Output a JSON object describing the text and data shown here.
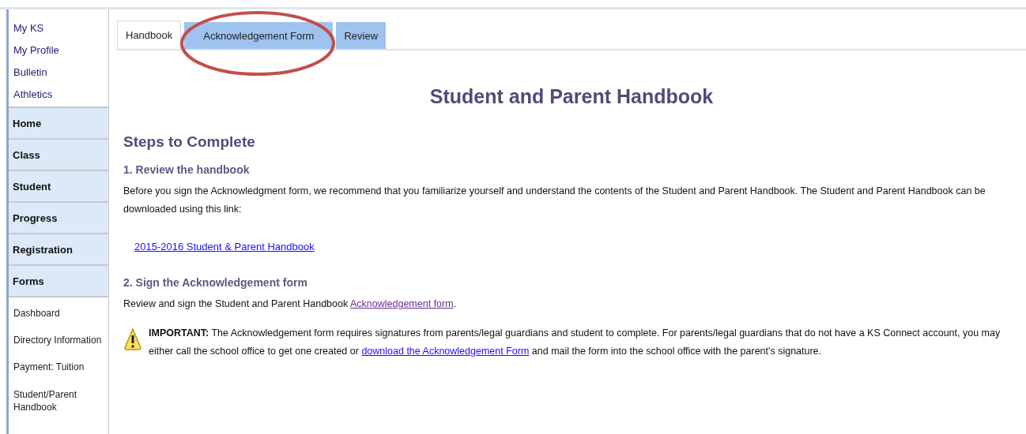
{
  "sidebar": {
    "links": [
      "My KS",
      "My Profile",
      "Bulletin",
      "Athletics"
    ],
    "sections": [
      "Home",
      "Class",
      "Student",
      "Progress",
      "Registration",
      "Forms"
    ],
    "sub_items": [
      "Dashboard",
      "Directory Information",
      "Payment: Tuition",
      "Student/Parent Handbook"
    ]
  },
  "tabs": [
    {
      "label": "Handbook",
      "selected": true
    },
    {
      "label": "Acknowledgement Form",
      "selected": false
    },
    {
      "label": "Review",
      "selected": false
    }
  ],
  "annotation": {
    "kind": "ellipse",
    "color": "#c0504d"
  },
  "content": {
    "title": "Student and Parent Handbook",
    "steps_heading": "Steps to Complete",
    "step_1": {
      "heading": "1. Review the handbook",
      "text": "Before you sign the Acknowledgment form, we recommend that you familiarize yourself and understand the contents of the Student and Parent Handbook. The Student and Parent Handbook can be downloaded using this link:",
      "link": {
        "label": "2015-2016 Student & Parent Handbook",
        "visited": false
      }
    },
    "step_2": {
      "heading": "2. Sign the Acknowledgement form",
      "text_before": "Review and sign the Student and Parent Handbook ",
      "link": {
        "label": "Acknowledgement form",
        "visited": true
      },
      "text_after": "."
    },
    "warning": {
      "text_before": "**IMPORTANT:** The Acknowledgement form requires signatures from parents/legal guardians and student to complete. For parents/legal guardians that do not have a KS Connect account, you may either call the school office to get one created or ",
      "link": {
        "label": "download the Acknowledgement Form",
        "visited": false
      },
      "text_after": " and mail the form into the school office with the parent's signature."
    }
  }
}
